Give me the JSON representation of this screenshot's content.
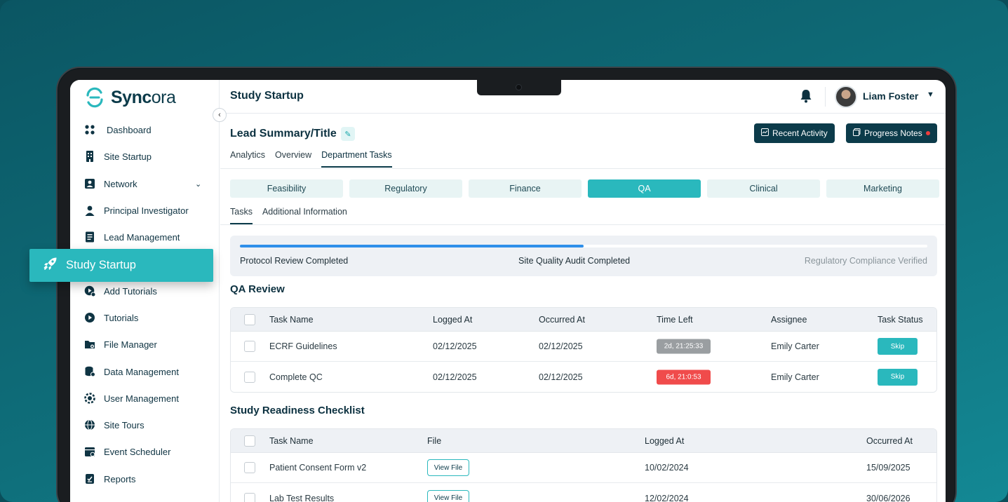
{
  "app": {
    "name": "Syncora"
  },
  "sidebar": {
    "items": [
      {
        "label": "Dashboard",
        "icon": "dashboard-icon"
      },
      {
        "label": "Site Startup",
        "icon": "building-icon"
      },
      {
        "label": "Network",
        "icon": "network-icon"
      },
      {
        "label": "Principal Investigator",
        "icon": "person-icon"
      },
      {
        "label": "Lead Management",
        "icon": "document-icon"
      },
      {
        "label": "Study Startup",
        "icon": "rocket-icon"
      },
      {
        "label": "Add Tutorials",
        "icon": "add-video-icon"
      },
      {
        "label": "Tutorials",
        "icon": "play-icon"
      },
      {
        "label": "File Manager",
        "icon": "folder-icon"
      },
      {
        "label": "Data Management",
        "icon": "database-icon"
      },
      {
        "label": "User Management",
        "icon": "users-gear-icon"
      },
      {
        "label": "Site Tours",
        "icon": "globe-icon"
      },
      {
        "label": "Event Scheduler",
        "icon": "calendar-icon"
      },
      {
        "label": "Reports",
        "icon": "report-icon"
      }
    ],
    "active": "Study Startup"
  },
  "header": {
    "title": "Study Startup",
    "user": "Liam Foster"
  },
  "lead": {
    "title": "Lead Summary/Title",
    "recent_activity": "Recent Activity",
    "progress_notes": "Progress Notes"
  },
  "tabs": [
    "Analytics",
    "Overview",
    "Department Tasks"
  ],
  "departments": [
    "Feasibility",
    "Regulatory",
    "Finance",
    "QA",
    "Clinical",
    "Marketing"
  ],
  "subtabs": [
    "Tasks",
    "Additional Information"
  ],
  "progress": {
    "value": 0.5,
    "steps": [
      "Protocol Review Completed",
      "Site Quality Audit Completed",
      "Regulatory Compliance Verified"
    ]
  },
  "qa_review": {
    "title": "QA Review",
    "columns": [
      "Task Name",
      "Logged At",
      "Occurred At",
      "Time Left",
      "Assignee",
      "Task Status"
    ],
    "rows": [
      {
        "task": "ECRF Guidelines",
        "logged": "02/12/2025",
        "occurred": "02/12/2025",
        "time_left": "2d, 21:25:33",
        "time_color": "#9a9ea1",
        "assignee": "Emily Carter",
        "status": "Skip"
      },
      {
        "task": "Complete QC",
        "logged": "02/12/2025",
        "occurred": "02/12/2025",
        "time_left": "6d, 21:0:53",
        "time_color": "#f04b4b",
        "assignee": "Emily Carter",
        "status": "Skip"
      }
    ]
  },
  "checklist": {
    "title": "Study Readiness Checklist",
    "columns": [
      "Task Name",
      "File",
      "Logged At",
      "Occurred At"
    ],
    "rows": [
      {
        "task": "Patient Consent Form v2",
        "file": "View File",
        "logged": "10/02/2024",
        "occurred": "15/09/2025"
      },
      {
        "task": "Lab Test Results",
        "file": "View File",
        "logged": "12/02/2024",
        "occurred": "30/06/2026"
      }
    ]
  },
  "colors": {
    "accent": "#2ab8bd",
    "primary": "#0c3b4a",
    "progress": "#2f8fea"
  }
}
